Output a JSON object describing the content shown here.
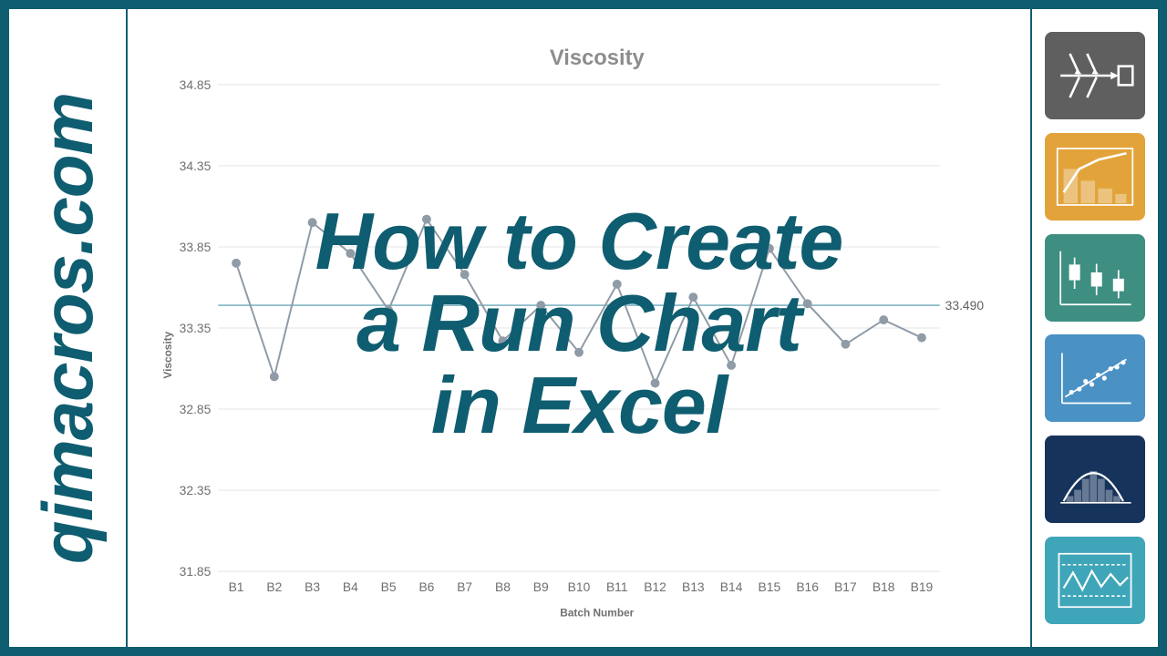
{
  "brand": {
    "url_text": "qimacros.com"
  },
  "headline": {
    "line1": "How to Create",
    "line2": "a Run Chart",
    "line3": "in Excel"
  },
  "icons": [
    {
      "name": "fishbone-diagram-icon"
    },
    {
      "name": "pareto-chart-icon"
    },
    {
      "name": "box-plot-icon"
    },
    {
      "name": "scatter-plot-icon"
    },
    {
      "name": "histogram-bell-icon"
    },
    {
      "name": "control-chart-icon"
    }
  ],
  "chart_data": {
    "type": "line",
    "title": "Viscosity",
    "xlabel": "Batch Number",
    "ylabel": "Viscosity",
    "ylim": [
      31.85,
      34.85
    ],
    "yticks": [
      31.85,
      32.35,
      32.85,
      33.35,
      33.85,
      34.35,
      34.85
    ],
    "categories": [
      "B1",
      "B2",
      "B3",
      "B4",
      "B5",
      "B6",
      "B7",
      "B8",
      "B9",
      "B10",
      "B11",
      "B12",
      "B13",
      "B14",
      "B15",
      "B16",
      "B17",
      "B18",
      "B19"
    ],
    "values": [
      33.75,
      33.05,
      34.0,
      33.81,
      33.46,
      34.02,
      33.68,
      33.27,
      33.49,
      33.2,
      33.62,
      33.01,
      33.54,
      33.12,
      33.84,
      33.5,
      33.25,
      33.4,
      33.29
    ],
    "center_line": 33.49,
    "center_line_label": "33.490"
  }
}
